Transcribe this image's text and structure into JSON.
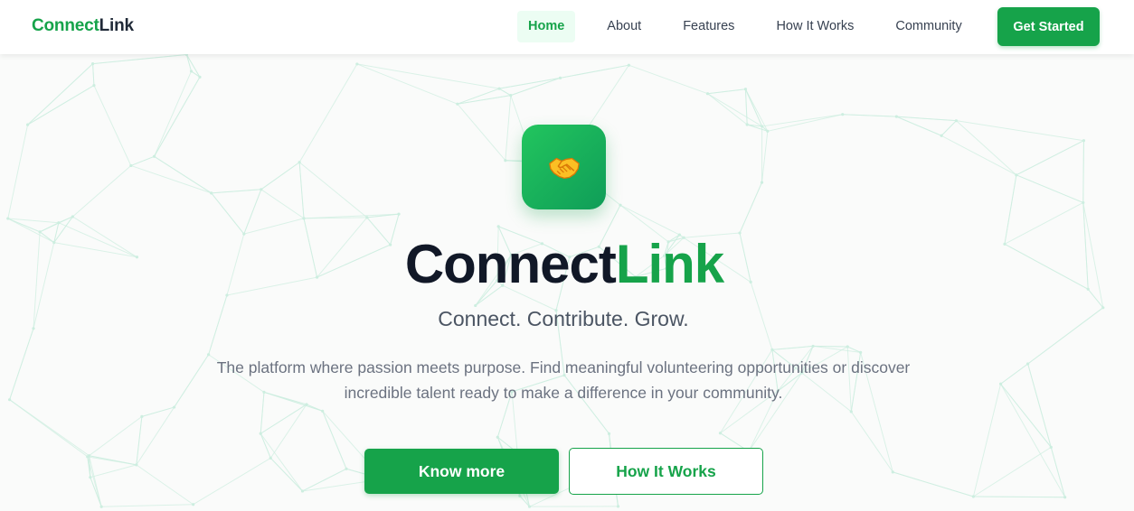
{
  "nav": {
    "brand_part1": "Connect",
    "brand_part2": "Link",
    "links": [
      {
        "label": "Home",
        "active": true
      },
      {
        "label": "About",
        "active": false
      },
      {
        "label": "Features",
        "active": false
      },
      {
        "label": "How It Works",
        "active": false
      },
      {
        "label": "Community",
        "active": false
      }
    ],
    "cta_label": "Get Started"
  },
  "hero": {
    "icon": "handshake-icon",
    "title_part1": "Connect",
    "title_part2": "Link",
    "tagline": "Connect. Contribute. Grow.",
    "description": "The platform where passion meets purpose. Find meaningful volunteering opportunities or discover incredible talent ready to make a difference in your community.",
    "primary_button": "Know more",
    "secondary_button": "How It Works"
  },
  "colors": {
    "brand_green": "#16a34a",
    "active_tab_bg": "#ecfdf3",
    "heading_dark": "#111827",
    "background": "#fafbfa",
    "network_lines": "#cdeee0"
  }
}
